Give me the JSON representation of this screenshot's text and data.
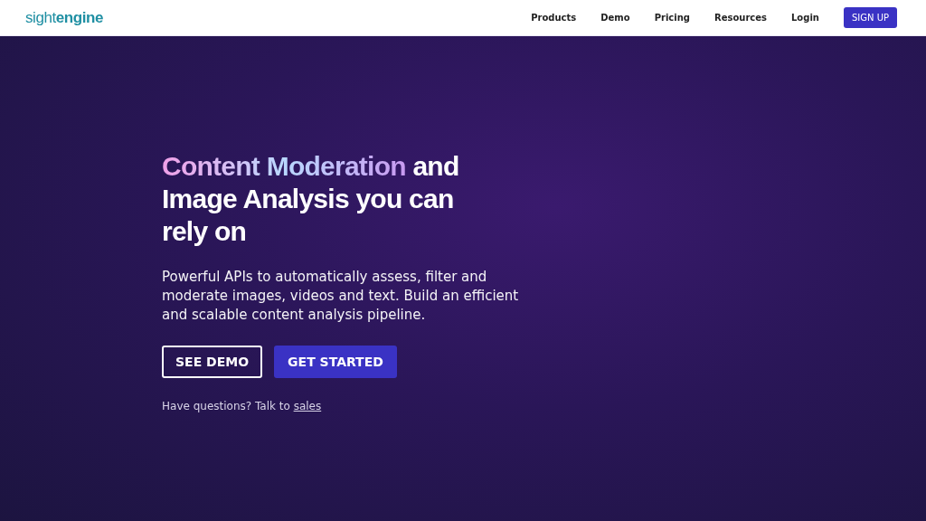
{
  "logo": {
    "light": "sight",
    "bold": "engine"
  },
  "nav": {
    "links": [
      "Products",
      "Demo",
      "Pricing",
      "Resources",
      "Login"
    ],
    "signup": "SIGN UP"
  },
  "hero": {
    "title_highlight": "Content Moderation",
    "title_rest": "and Image Analysis you can rely on",
    "description": "Powerful APIs to automatically assess, filter and moderate images, videos and text. Build an efficient and scalable content analysis pipeline.",
    "buttons": [
      {
        "label": "SEE DEMO",
        "kind": "outline"
      },
      {
        "label": "GET STARTED",
        "kind": "primary"
      }
    ],
    "contact": {
      "text": "Have questions? Talk to",
      "link": "sales"
    }
  }
}
